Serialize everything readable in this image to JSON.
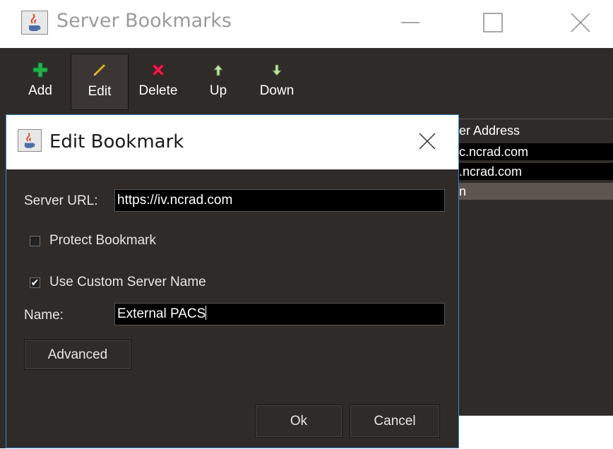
{
  "outer_window": {
    "title": "Server Bookmarks",
    "app_icon": "java-cup-icon",
    "controls": [
      "minimize-icon",
      "maximize-icon",
      "close-icon"
    ]
  },
  "toolbar": {
    "items": [
      {
        "label": "Add",
        "icon": "plus-icon",
        "color": "#22b14c"
      },
      {
        "label": "Edit",
        "icon": "pencil-icon",
        "color": "#f0c040"
      },
      {
        "label": "Delete",
        "icon": "x-icon",
        "color": "#e81f4f"
      },
      {
        "label": "Up",
        "icon": "arrow-up-icon",
        "color": "#c5e3b0"
      },
      {
        "label": "Down",
        "icon": "arrow-down-icon",
        "color": "#c5e3b0"
      }
    ]
  },
  "bookmark_table": {
    "header_fragment": "er Address",
    "rows": [
      {
        "text": "c.ncrad.com",
        "selected": true
      },
      {
        "text": ".ncrad.com",
        "selected": true
      },
      {
        "text": "n",
        "selected": false
      }
    ]
  },
  "dialog": {
    "title": "Edit Bookmark",
    "app_icon": "java-cup-icon",
    "server_url_label": "Server URL:",
    "server_url_value": "https://iv.ncrad.com",
    "protect_label": "Protect Bookmark",
    "protect_checked": false,
    "custom_name_label": "Use Custom Server Name",
    "custom_name_checked": true,
    "name_label": "Name:",
    "name_value": "External PACS",
    "advanced_label": "Advanced",
    "ok_label": "Ok",
    "cancel_label": "Cancel"
  },
  "colors": {
    "background": "#2f2b29",
    "selected_row": "#000000",
    "highlight_row": "#5e5450",
    "dialog_border": "#3c86c8"
  }
}
